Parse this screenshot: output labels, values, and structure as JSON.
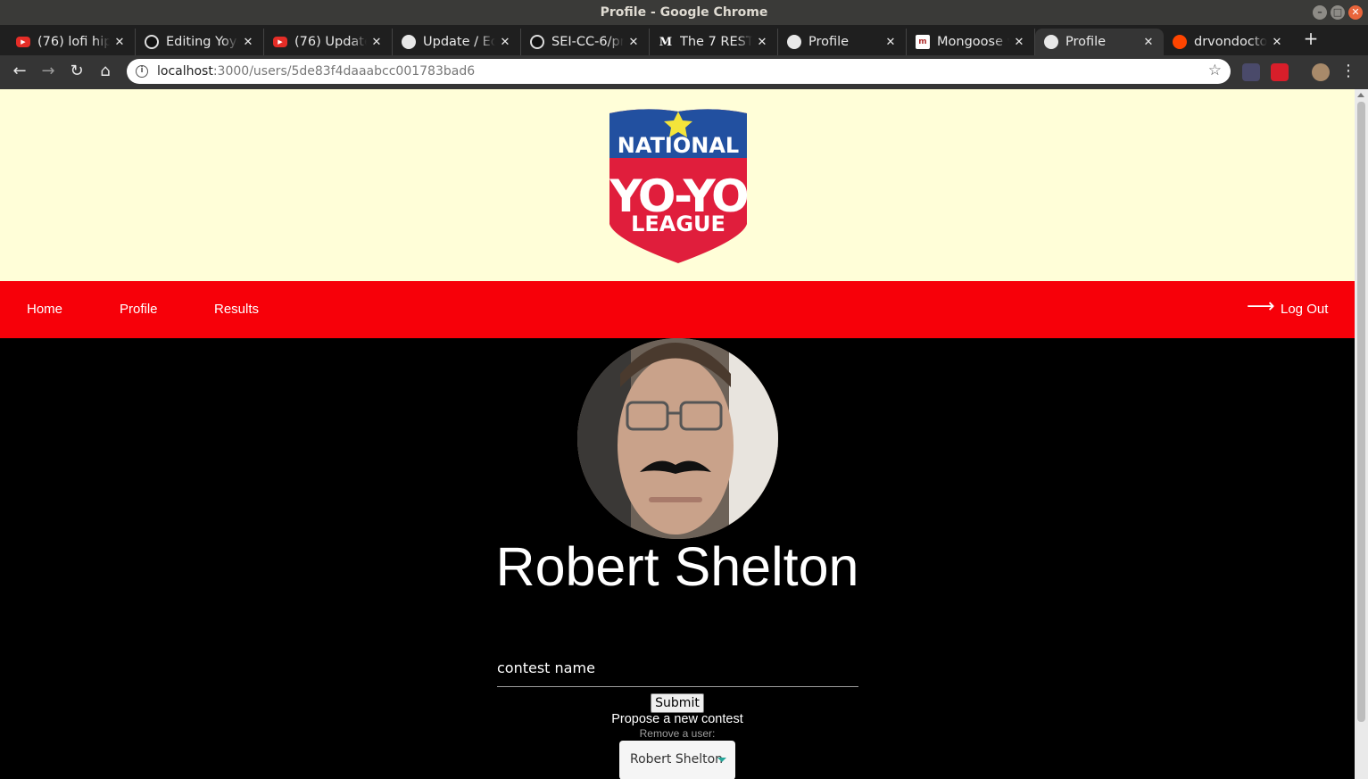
{
  "window": {
    "title": "Profile - Google Chrome"
  },
  "tabs": [
    {
      "title": "(76) lofi hip",
      "icon": "youtube-icon"
    },
    {
      "title": "Editing Yoyo",
      "icon": "github-icon"
    },
    {
      "title": "(76) Update",
      "icon": "youtube-icon"
    },
    {
      "title": "Update / Ed",
      "icon": "globe-icon"
    },
    {
      "title": "SEI-CC-6/pr",
      "icon": "github-icon"
    },
    {
      "title": "The 7 RESTf",
      "icon": "medium-icon"
    },
    {
      "title": "Profile",
      "icon": "globe-icon"
    },
    {
      "title": "Mongoose v",
      "icon": "mongoose-icon"
    },
    {
      "title": "Profile",
      "icon": "globe-icon",
      "active": true
    },
    {
      "title": "drvondocto",
      "icon": "reddit-icon"
    }
  ],
  "address": {
    "host": "localhost",
    "path": ":3000/users/5de83f4daaabcc001783bad6"
  },
  "logo": {
    "top": "NATIONAL",
    "middle": "YO-YO",
    "bottom": "LEAGUE"
  },
  "nav": {
    "home": "Home",
    "profile": "Profile",
    "results": "Results",
    "logout": "Log Out"
  },
  "profile": {
    "name": "Robert Shelton"
  },
  "contest_form": {
    "placeholder": "contest name",
    "submit_label": "Submit",
    "caption": "Propose a new contest"
  },
  "remove_user": {
    "label": "Remove a user:",
    "selected": "Robert Shelton"
  },
  "colors": {
    "header_bg": "#fffed8",
    "nav_bg": "#f70009",
    "page_bg": "#000000",
    "select_caret": "#26a69a"
  }
}
